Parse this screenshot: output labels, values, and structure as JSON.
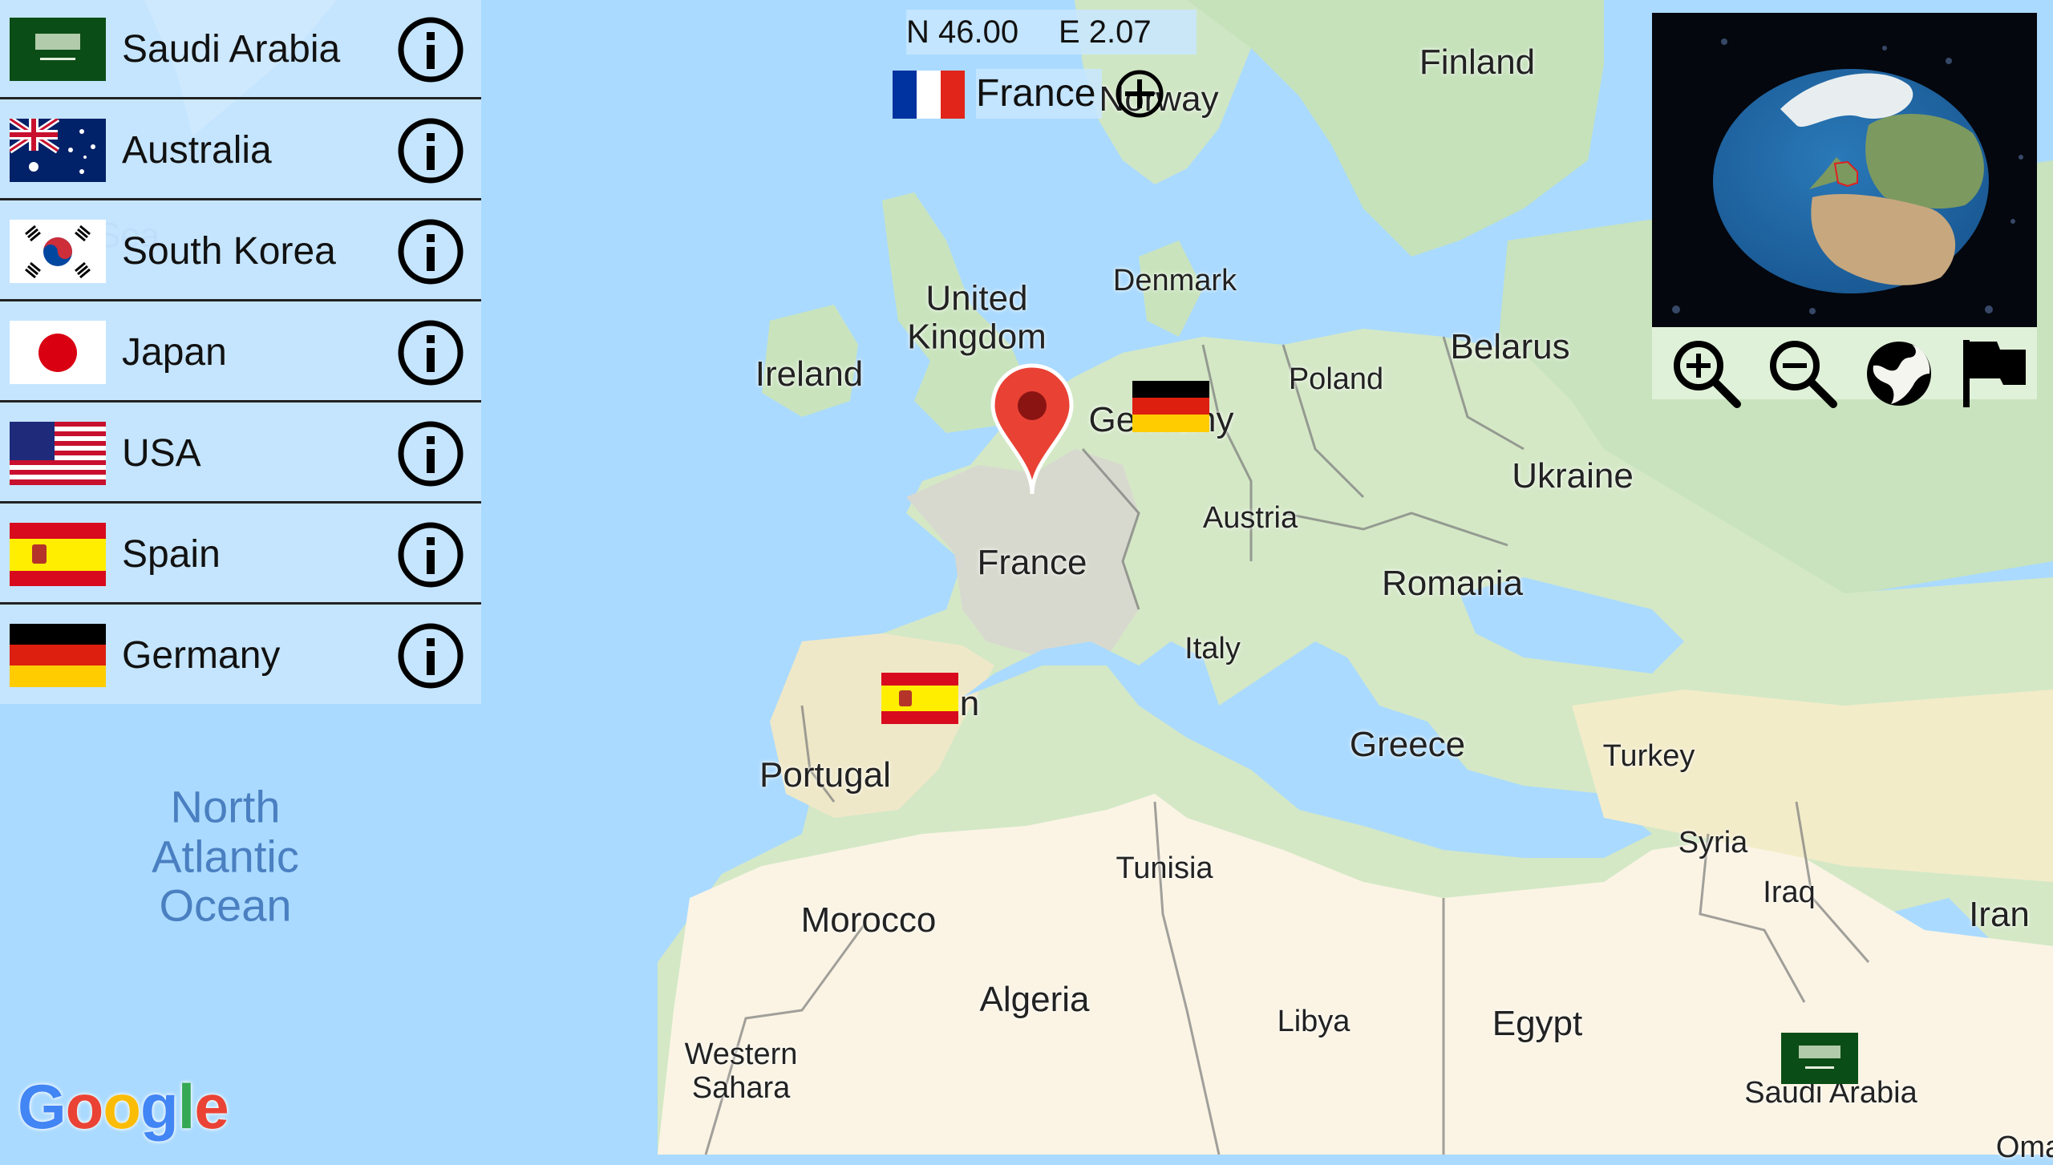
{
  "country_list": [
    {
      "name": "Saudi Arabia",
      "flag": "saudi-arabia-flag"
    },
    {
      "name": "Australia",
      "flag": "australia-flag"
    },
    {
      "name": "South Korea",
      "flag": "south-korea-flag"
    },
    {
      "name": "Japan",
      "flag": "japan-flag"
    },
    {
      "name": "USA",
      "flag": "usa-flag"
    },
    {
      "name": "Spain",
      "flag": "spain-flag"
    },
    {
      "name": "Germany",
      "flag": "germany-flag"
    }
  ],
  "info_icon": "info-icon",
  "coordinates": {
    "lat": "N 46.00",
    "lon": "E 2.07"
  },
  "selected_country": {
    "name": "France",
    "flag": "france-flag"
  },
  "globe": {
    "highlighted_country": "France",
    "highlight_color": "#e02020"
  },
  "toolbar": [
    {
      "icon": "zoom-in-icon"
    },
    {
      "icon": "zoom-out-icon"
    },
    {
      "icon": "globe-icon"
    },
    {
      "icon": "flag-icon"
    }
  ],
  "map": {
    "provider_logo": "Google",
    "logo_letters": [
      {
        "ch": "G",
        "color": "#4285F4"
      },
      {
        "ch": "o",
        "color": "#EA4335"
      },
      {
        "ch": "o",
        "color": "#FBBC05"
      },
      {
        "ch": "g",
        "color": "#4285F4"
      },
      {
        "ch": "l",
        "color": "#34A853"
      },
      {
        "ch": "e",
        "color": "#EA4335"
      }
    ],
    "labels": {
      "finland": "Finland",
      "norway": "Norway",
      "united_kingdom": "United\nKingdom",
      "ireland": "Ireland",
      "denmark": "Denmark",
      "belarus": "Belarus",
      "poland": "Poland",
      "germany": "Germany",
      "ukraine": "Ukraine",
      "austria": "Austria",
      "france": "France",
      "romania": "Romania",
      "italy": "Italy",
      "spain": "Spain",
      "greece": "Greece",
      "turkey": "Turkey",
      "portugal": "Portugal",
      "syria": "Syria",
      "iraq": "Iraq",
      "iran": "Iran",
      "tunisia": "Tunisia",
      "morocco": "Morocco",
      "algeria": "Algeria",
      "libya": "Libya",
      "egypt": "Egypt",
      "western_sahara": "Western\nSahara",
      "saudi_arabia": "Saudi Arabia",
      "oman": "Oma",
      "north_atlantic": "North\nAtlantic\nOcean",
      "sea": "Sea"
    },
    "flag_markers": [
      {
        "country": "Germany",
        "flag": "germany-flag"
      },
      {
        "country": "Spain",
        "flag": "spain-flag"
      },
      {
        "country": "Saudi Arabia",
        "flag": "saudi-arabia-flag"
      }
    ],
    "pin_color": "#e94235"
  }
}
